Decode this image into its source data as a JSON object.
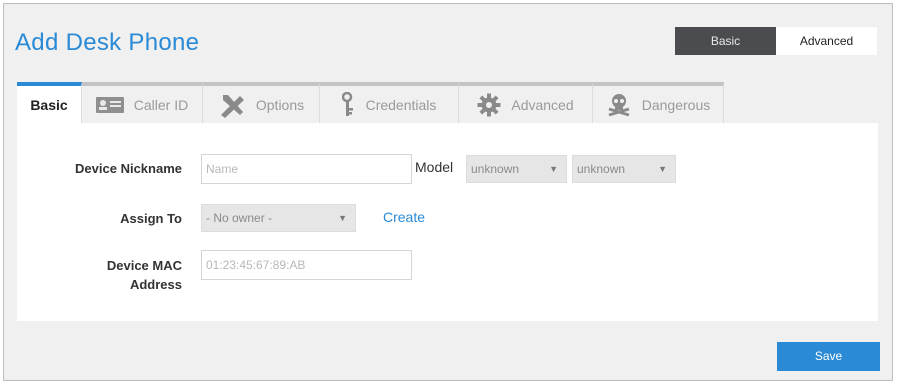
{
  "dialog": {
    "title": "Add Desk Phone",
    "mode_toggle": {
      "basic_label": "Basic",
      "advanced_label": "Advanced",
      "selected": "Basic"
    }
  },
  "tabs": [
    {
      "label": "Basic",
      "icon": "none",
      "active": true
    },
    {
      "label": "Caller ID",
      "icon": "id-card-icon",
      "active": false
    },
    {
      "label": "Options",
      "icon": "tools-icon",
      "active": false
    },
    {
      "label": "Credentials",
      "icon": "key-icon",
      "active": false
    },
    {
      "label": "Advanced",
      "icon": "gear-icon",
      "active": false
    },
    {
      "label": "Dangerous",
      "icon": "skull-icon",
      "active": false
    }
  ],
  "form": {
    "device_nickname": {
      "label": "Device Nickname",
      "value": "",
      "placeholder": "Name"
    },
    "model": {
      "label": "Model",
      "brand_value": "unknown",
      "model_value": "unknown"
    },
    "assign_to": {
      "label": "Assign To",
      "value": "- No owner -",
      "create_link": "Create"
    },
    "mac_address": {
      "label_line1": "Device MAC",
      "label_line2": "Address",
      "value": "",
      "placeholder": "01:23:45:67:89:AB"
    }
  },
  "footer": {
    "save_label": "Save"
  },
  "colors": {
    "accent": "#2a8ad6",
    "toggle_active_bg": "#4a4c50",
    "panel_bg": "#f0f0f0"
  }
}
